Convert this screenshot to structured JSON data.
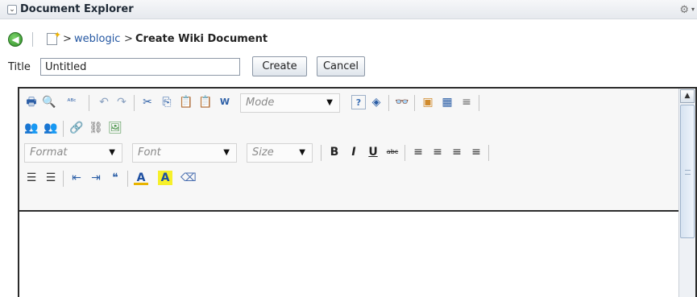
{
  "panel": {
    "title": "Document Explorer",
    "collapse_glyph": "⌄",
    "settings_glyph": "⚙",
    "settings_caret": "▾"
  },
  "breadcrumb": {
    "back_glyph": "◀",
    "sep": ">",
    "link": "weblogic",
    "current": "Create Wiki Document"
  },
  "form": {
    "title_label": "Title",
    "title_value": "Untitled",
    "create_label": "Create",
    "cancel_label": "Cancel"
  },
  "editor": {
    "mode_placeholder": "Mode",
    "format_placeholder": "Format",
    "font_placeholder": "Font",
    "size_placeholder": "Size",
    "combo_arrow": "▼",
    "row1_icons": [
      {
        "name": "print-icon",
        "glyph": "🖶"
      },
      {
        "name": "preview-icon",
        "glyph": "🔍"
      },
      {
        "name": "spellcheck-icon",
        "glyph": "ᴬᴮᶜ"
      },
      {
        "name": "undo-icon",
        "glyph": "↶"
      },
      {
        "name": "redo-icon",
        "glyph": "↷"
      },
      {
        "name": "cut-icon",
        "glyph": "✂"
      },
      {
        "name": "copy-icon",
        "glyph": "⎘"
      },
      {
        "name": "paste-icon",
        "glyph": "📋"
      },
      {
        "name": "paste-text-icon",
        "glyph": "📋"
      },
      {
        "name": "paste-word-icon",
        "glyph": "W"
      },
      {
        "name": "help-icon",
        "glyph": "?"
      },
      {
        "name": "maximize-icon",
        "glyph": "◈"
      },
      {
        "name": "find-icon",
        "glyph": "👓"
      },
      {
        "name": "insert-image-icon",
        "glyph": "▣"
      },
      {
        "name": "insert-table-icon",
        "glyph": "▦"
      },
      {
        "name": "horizontal-rule-icon",
        "glyph": "≡"
      }
    ],
    "row2_icons": [
      {
        "name": "anchor-icon",
        "glyph": "👥"
      },
      {
        "name": "remove-anchor-icon",
        "glyph": "👥"
      },
      {
        "name": "link-icon",
        "glyph": "🔗"
      },
      {
        "name": "unlink-icon",
        "glyph": "⛓"
      },
      {
        "name": "image-icon",
        "glyph": "🖼"
      }
    ],
    "row3_icons": [
      {
        "name": "bold-icon",
        "glyph": "B"
      },
      {
        "name": "italic-icon",
        "glyph": "I"
      },
      {
        "name": "underline-icon",
        "glyph": "U"
      },
      {
        "name": "strikethrough-icon",
        "glyph": "abc"
      },
      {
        "name": "align-left-icon",
        "glyph": "≡"
      },
      {
        "name": "align-center-icon",
        "glyph": "≡"
      },
      {
        "name": "align-right-icon",
        "glyph": "≡"
      },
      {
        "name": "justify-icon",
        "glyph": "≡"
      }
    ],
    "row4_icons": [
      {
        "name": "numbered-list-icon",
        "glyph": "☰"
      },
      {
        "name": "bulleted-list-icon",
        "glyph": "☰"
      },
      {
        "name": "outdent-icon",
        "glyph": "⇤"
      },
      {
        "name": "indent-icon",
        "glyph": "⇥"
      },
      {
        "name": "blockquote-icon",
        "glyph": "❝"
      },
      {
        "name": "text-color-icon",
        "glyph": "A"
      },
      {
        "name": "background-color-icon",
        "glyph": "A"
      },
      {
        "name": "eraser-icon",
        "glyph": "⌫"
      }
    ],
    "scroll_up_glyph": "▲"
  }
}
